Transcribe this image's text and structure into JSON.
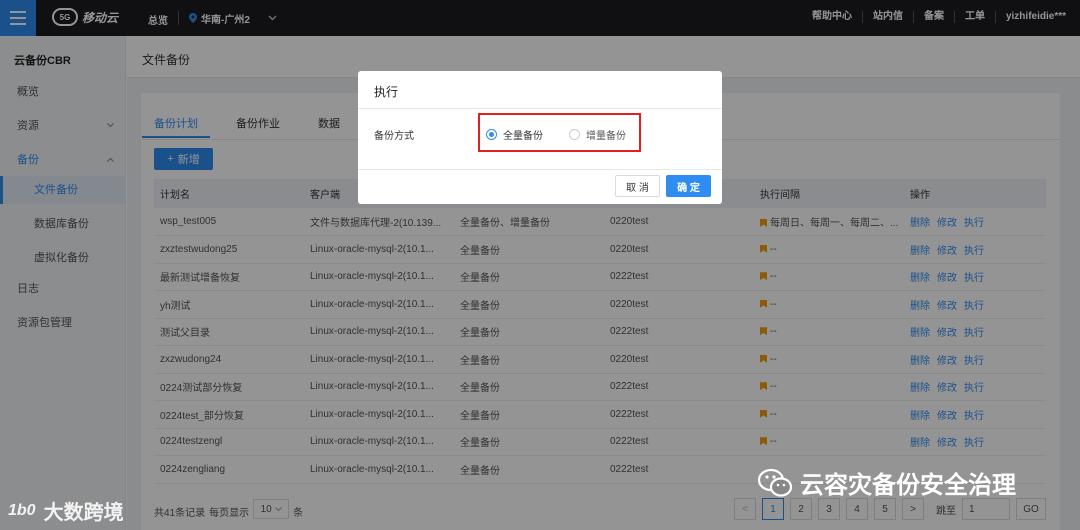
{
  "topbar": {
    "logo_text": "移动云",
    "logo_badge": "5G",
    "overview": "总览",
    "region": "华南-广州2",
    "right_links": [
      "帮助中心",
      "站内信",
      "备案",
      "工单"
    ],
    "user": "yizhifeidie***"
  },
  "sidebar": {
    "title": "云备份CBR",
    "items": [
      {
        "label": "概览"
      },
      {
        "label": "资源"
      },
      {
        "label": "备份"
      },
      {
        "label": "文件备份"
      },
      {
        "label": "数据库备份"
      },
      {
        "label": "虚拟化备份"
      },
      {
        "label": "日志"
      },
      {
        "label": "资源包管理"
      }
    ]
  },
  "page": {
    "title": "文件备份",
    "tabs": [
      "备份计划",
      "备份作业",
      "数据"
    ],
    "add_button": "新增"
  },
  "table": {
    "headers": [
      "计划名",
      "客户端",
      "",
      "",
      "执行间隔",
      "操作"
    ],
    "rows": [
      [
        "wsp_test005",
        "文件与数据库代理-2(10.139...",
        "全量备份、增量备份",
        "0220test",
        "每周日、每周一、每周二、...",
        "删除",
        "修改",
        "执行"
      ],
      [
        "zxztestwudong25",
        "Linux-oracle-mysql-2(10.1...",
        "全量备份",
        "0220test",
        "--",
        "删除",
        "修改",
        "执行"
      ],
      [
        "最新测试增备恢复",
        "Linux-oracle-mysql-2(10.1...",
        "全量备份",
        "0222test",
        "--",
        "删除",
        "修改",
        "执行"
      ],
      [
        "yh测试",
        "Linux-oracle-mysql-2(10.1...",
        "全量备份",
        "0220test",
        "--",
        "删除",
        "修改",
        "执行"
      ],
      [
        "测试父目录",
        "Linux-oracle-mysql-2(10.1...",
        "全量备份",
        "0222test",
        "--",
        "删除",
        "修改",
        "执行"
      ],
      [
        "zxzwudong24",
        "Linux-oracle-mysql-2(10.1...",
        "全量备份",
        "0220test",
        "--",
        "删除",
        "修改",
        "执行"
      ],
      [
        "0224测试部分恢复",
        "Linux-oracle-mysql-2(10.1...",
        "全量备份",
        "0222test",
        "--",
        "删除",
        "修改",
        "执行"
      ],
      [
        "0224test_部分恢复",
        "Linux-oracle-mysql-2(10.1...",
        "全量备份",
        "0222test",
        "--",
        "删除",
        "修改",
        "执行"
      ],
      [
        "0224testzengl",
        "Linux-oracle-mysql-2(10.1...",
        "全量备份",
        "0222test",
        "--",
        "删除",
        "修改",
        "执行"
      ],
      [
        "0224zengliang",
        "Linux-oracle-mysql-2(10.1...",
        "全量备份",
        "0222test",
        "",
        "",
        "",
        ""
      ]
    ]
  },
  "pager": {
    "total": "共41条记录",
    "per_page_label": "每页显示",
    "per_page": "10",
    "unit": "条",
    "prev": "<",
    "pages": [
      "1",
      "2",
      "3",
      "4",
      "5"
    ],
    "next": ">",
    "jump_label": "跳至",
    "jump_value": "1",
    "go": "GO"
  },
  "modal": {
    "title": "执行",
    "label": "备份方式",
    "options": [
      "全量备份",
      "增量备份"
    ],
    "selected": "全量备份",
    "cancel": "取 消",
    "confirm": "确 定"
  },
  "watermarks": {
    "left_mark": "1b0",
    "left": "大数跨境",
    "right": "云容灾备份安全治理"
  },
  "colors": {
    "accent": "#2f8cf0",
    "highlight": "#e02020",
    "flag": "#f39c12"
  }
}
